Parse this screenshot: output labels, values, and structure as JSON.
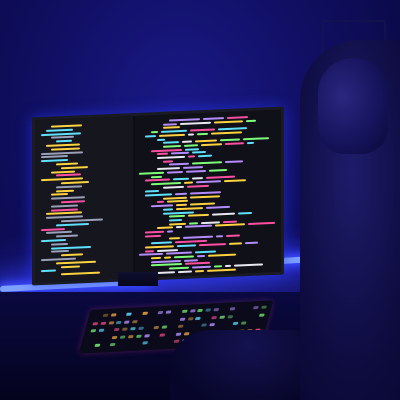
{
  "scene": {
    "palette": {
      "ambient": "#100f63",
      "led": "#3d4dff",
      "code_pink": "#ff4fa3",
      "code_yellow": "#ffd23f",
      "code_cyan": "#5ee0ff",
      "code_green": "#7dff7a",
      "code_purple": "#b48cff",
      "code_white": "#e8e8f0"
    }
  }
}
